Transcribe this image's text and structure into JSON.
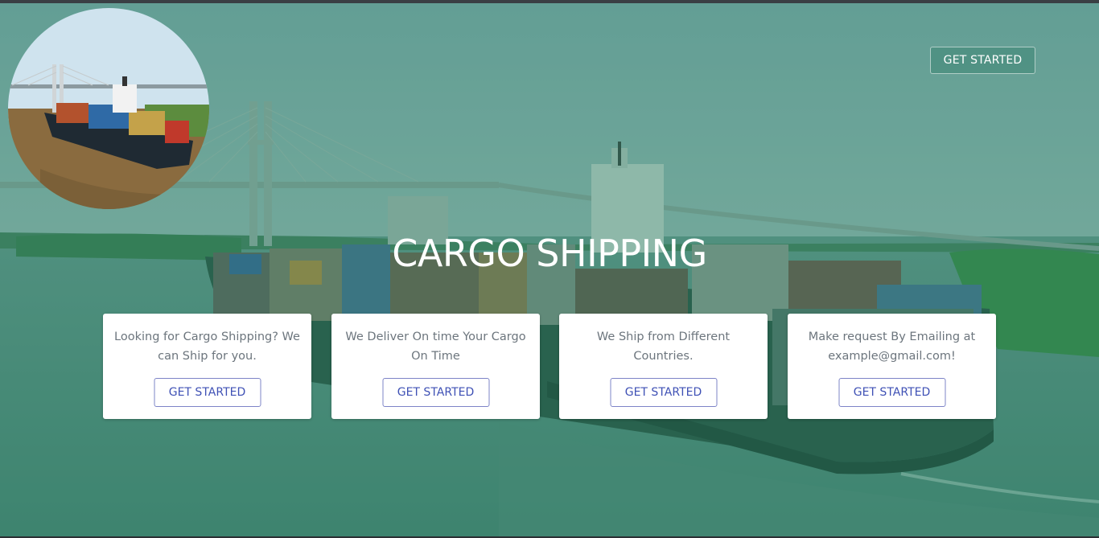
{
  "header": {
    "cta_label": "GET STARTED"
  },
  "hero": {
    "title": "CARGO SHIPPING"
  },
  "cards": [
    {
      "text": "Looking for Cargo Shipping? We can Ship for you.",
      "button_label": "GET STARTED"
    },
    {
      "text": "We Deliver On time Your Cargo On Time",
      "button_label": "GET STARTED"
    },
    {
      "text": "We Ship from Different Countries.",
      "button_label": "GET STARTED"
    },
    {
      "text": "Make request By Emailing at example@gmail.com!",
      "button_label": "GET STARTED"
    }
  ],
  "colors": {
    "overlay": "#268264",
    "card_button_text": "#3f51b5",
    "card_text": "#6c757d"
  }
}
